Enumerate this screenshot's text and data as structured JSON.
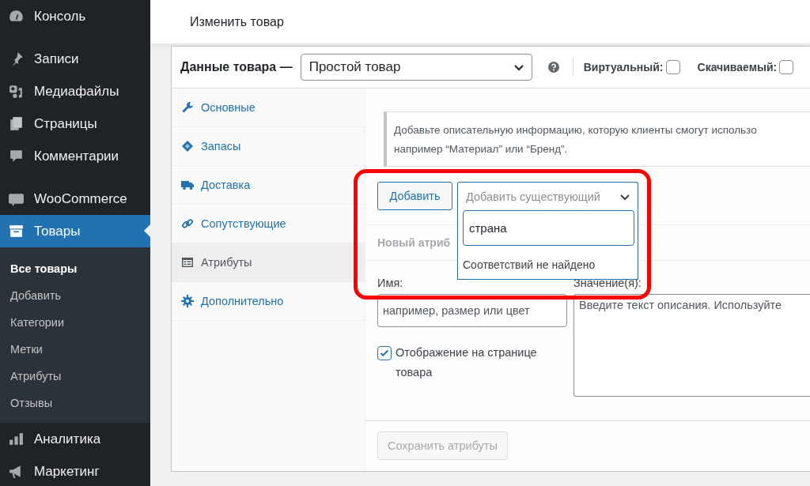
{
  "sidebar": {
    "groups": [
      [
        {
          "label": "Консоль",
          "selected": false
        }
      ],
      [
        {
          "label": "Записи",
          "selected": false
        },
        {
          "label": "Медиафайлы",
          "selected": false
        },
        {
          "label": "Страницы",
          "selected": false
        },
        {
          "label": "Комментарии",
          "selected": false
        }
      ],
      [
        {
          "label": "WooCommerce",
          "selected": false
        },
        {
          "label": "Товары",
          "selected": true,
          "children": [
            {
              "label": "Все товары",
              "selected": true
            },
            {
              "label": "Добавить",
              "selected": false
            },
            {
              "label": "Категории",
              "selected": false
            },
            {
              "label": "Метки",
              "selected": false
            },
            {
              "label": "Атрибуты",
              "selected": false
            },
            {
              "label": "Отзывы",
              "selected": false
            }
          ]
        }
      ],
      [
        {
          "label": "Аналитика",
          "selected": false
        },
        {
          "label": "Маркетинг",
          "selected": false
        }
      ]
    ]
  },
  "page_title": "Изменить товар",
  "product_data": {
    "title": "Данные товара —",
    "type_select": {
      "value": "Простой товар"
    },
    "options": [
      {
        "label": "Виртуальный:",
        "checked": false
      },
      {
        "label": "Скачиваемый:",
        "checked": false
      }
    ],
    "tabs": [
      {
        "label": "Основные",
        "selected": false
      },
      {
        "label": "Запасы",
        "selected": false
      },
      {
        "label": "Доставка",
        "selected": false
      },
      {
        "label": "Сопутствующие",
        "selected": false
      },
      {
        "label": "Атрибуты",
        "selected": true
      },
      {
        "label": "Дополнительно",
        "selected": false
      }
    ],
    "notice": [
      "Добавьте описательную информацию, которую клиенты смогут использо",
      "например “Материал” или “Бренд”."
    ],
    "add_button": "Добавить",
    "existing_select": {
      "placeholder": "Добавить существующий",
      "expanded": true,
      "search_value": "страна",
      "message": "Соответствий не найдено"
    },
    "new_attribute_heading": "Новый атриб",
    "name_field": {
      "label": "Имя:",
      "placeholder": "например, размер или цвет"
    },
    "value_field": {
      "label": "Значение(я):",
      "placeholder": "Введите текст описания. Используйте"
    },
    "visible_checkbox": {
      "label": "Отображение на странице товара",
      "checked": true
    },
    "save_button": {
      "label": "Сохранить атрибуты",
      "disabled": true
    }
  }
}
